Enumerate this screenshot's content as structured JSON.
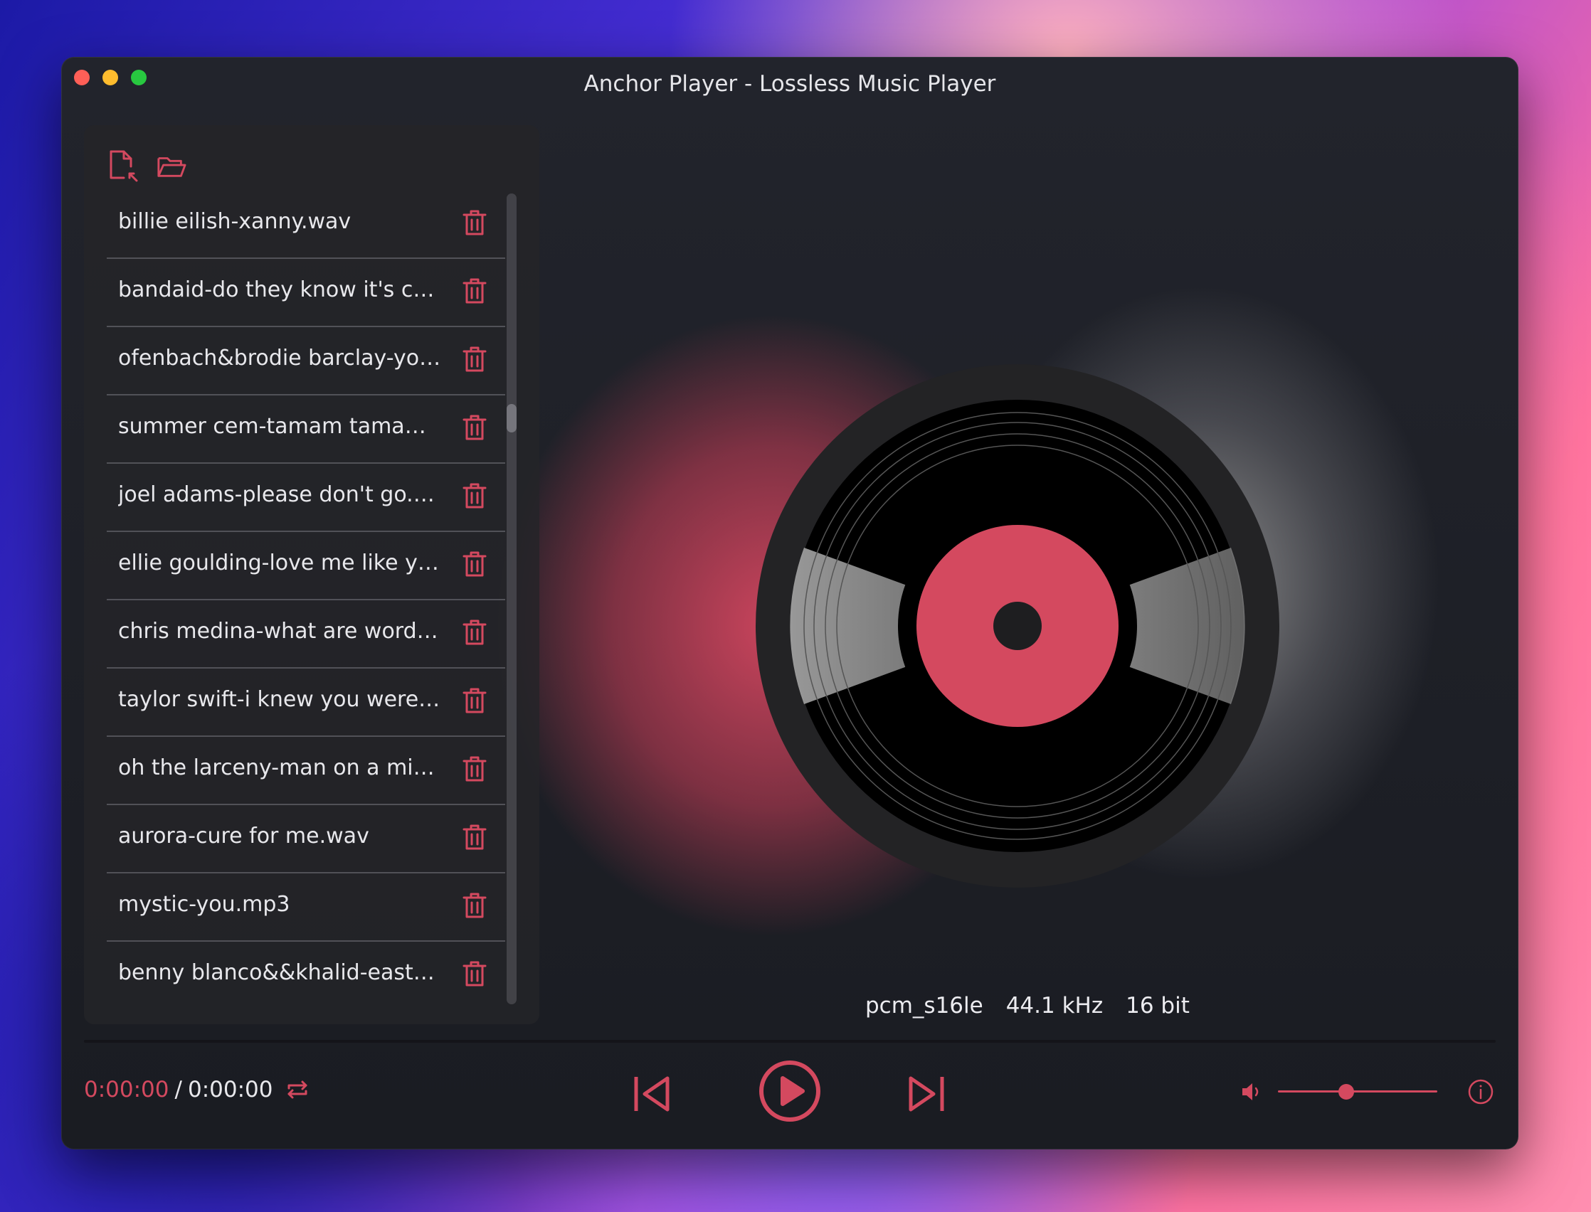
{
  "window": {
    "title": "Anchor Player - Lossless Music Player"
  },
  "sidebar": {
    "add_file_icon": "file-import-icon",
    "add_folder_icon": "folder-open-icon",
    "playlist": [
      {
        "name": "billie eilish-xanny.wav"
      },
      {
        "name": "bandaid-do they know it's chr…"
      },
      {
        "name": "ofenbach&brodie barclay-you…"
      },
      {
        "name": "summer cem-tamam tamam.…"
      },
      {
        "name": "joel adams-please don't go.wav"
      },
      {
        "name": "ellie goulding-love me like yo…"
      },
      {
        "name": "chris medina-what are words.…"
      },
      {
        "name": "taylor swift-i knew you were tr…"
      },
      {
        "name": "oh the larceny-man on a missi…"
      },
      {
        "name": "aurora-cure for me.wav"
      },
      {
        "name": "mystic-you.mp3"
      },
      {
        "name": "benny blanco&&khalid-eastsi…"
      }
    ],
    "delete_icon": "trash-icon"
  },
  "audio_info": {
    "codec": "pcm_s16le",
    "sample_rate": "44.1 kHz",
    "bit_depth": "16 bit"
  },
  "controls": {
    "current_time": "0:00:00",
    "separator": "/",
    "total_time": "0:00:00",
    "volume_level": 0.43,
    "repeat_icon": "repeat-icon",
    "prev_icon": "skip-previous-icon",
    "play_icon": "play-icon",
    "next_icon": "skip-next-icon",
    "volume_icon": "volume-icon",
    "info_icon": "info-icon"
  },
  "colors": {
    "accent": "#d4495f",
    "text": "#e8e8ec"
  }
}
